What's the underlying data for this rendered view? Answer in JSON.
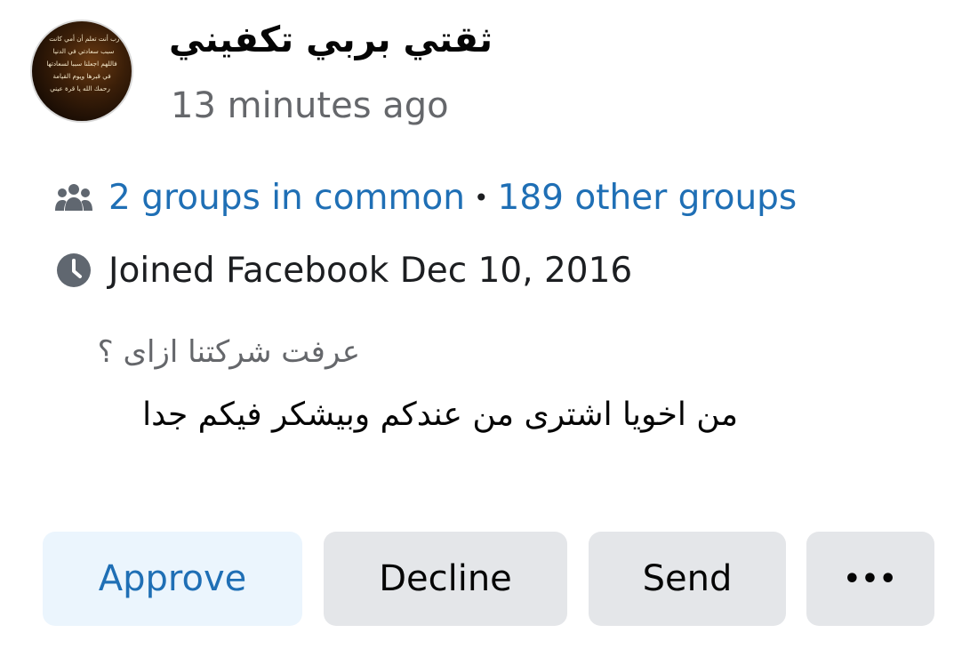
{
  "member": {
    "name": "ثقتي بربي تكفيني",
    "posted_time": "13 minutes ago",
    "avatar_caption_lines": [
      "يا رب أنت تعلم أن أمي كانت",
      "سبب سعادتي في الدنيا",
      "فاللهم اجعلنا سببا لسعادتها",
      "في قبرها ويوم القيامة",
      "رحمك الله يا قرة عيني"
    ]
  },
  "groups": {
    "icon": "people-group-icon",
    "in_common": "2 groups in common",
    "separator": "•",
    "other": "189 other groups"
  },
  "joined": {
    "icon": "clock-icon",
    "text": "Joined Facebook Dec 10, 2016"
  },
  "membership_answer": {
    "question": "عرفت شركتنا ازاى ؟",
    "answer": "من اخويا اشترى من عندكم وبيشكر فيكم جدا"
  },
  "actions": {
    "approve_label": "Approve",
    "decline_label": "Decline",
    "send_label": "Send",
    "more_label": "•••"
  },
  "colors": {
    "link_blue": "#1f6fb5",
    "approve_bg": "#ebf5fd",
    "button_gray": "#e4e6e9",
    "secondary_text": "#65676b"
  }
}
